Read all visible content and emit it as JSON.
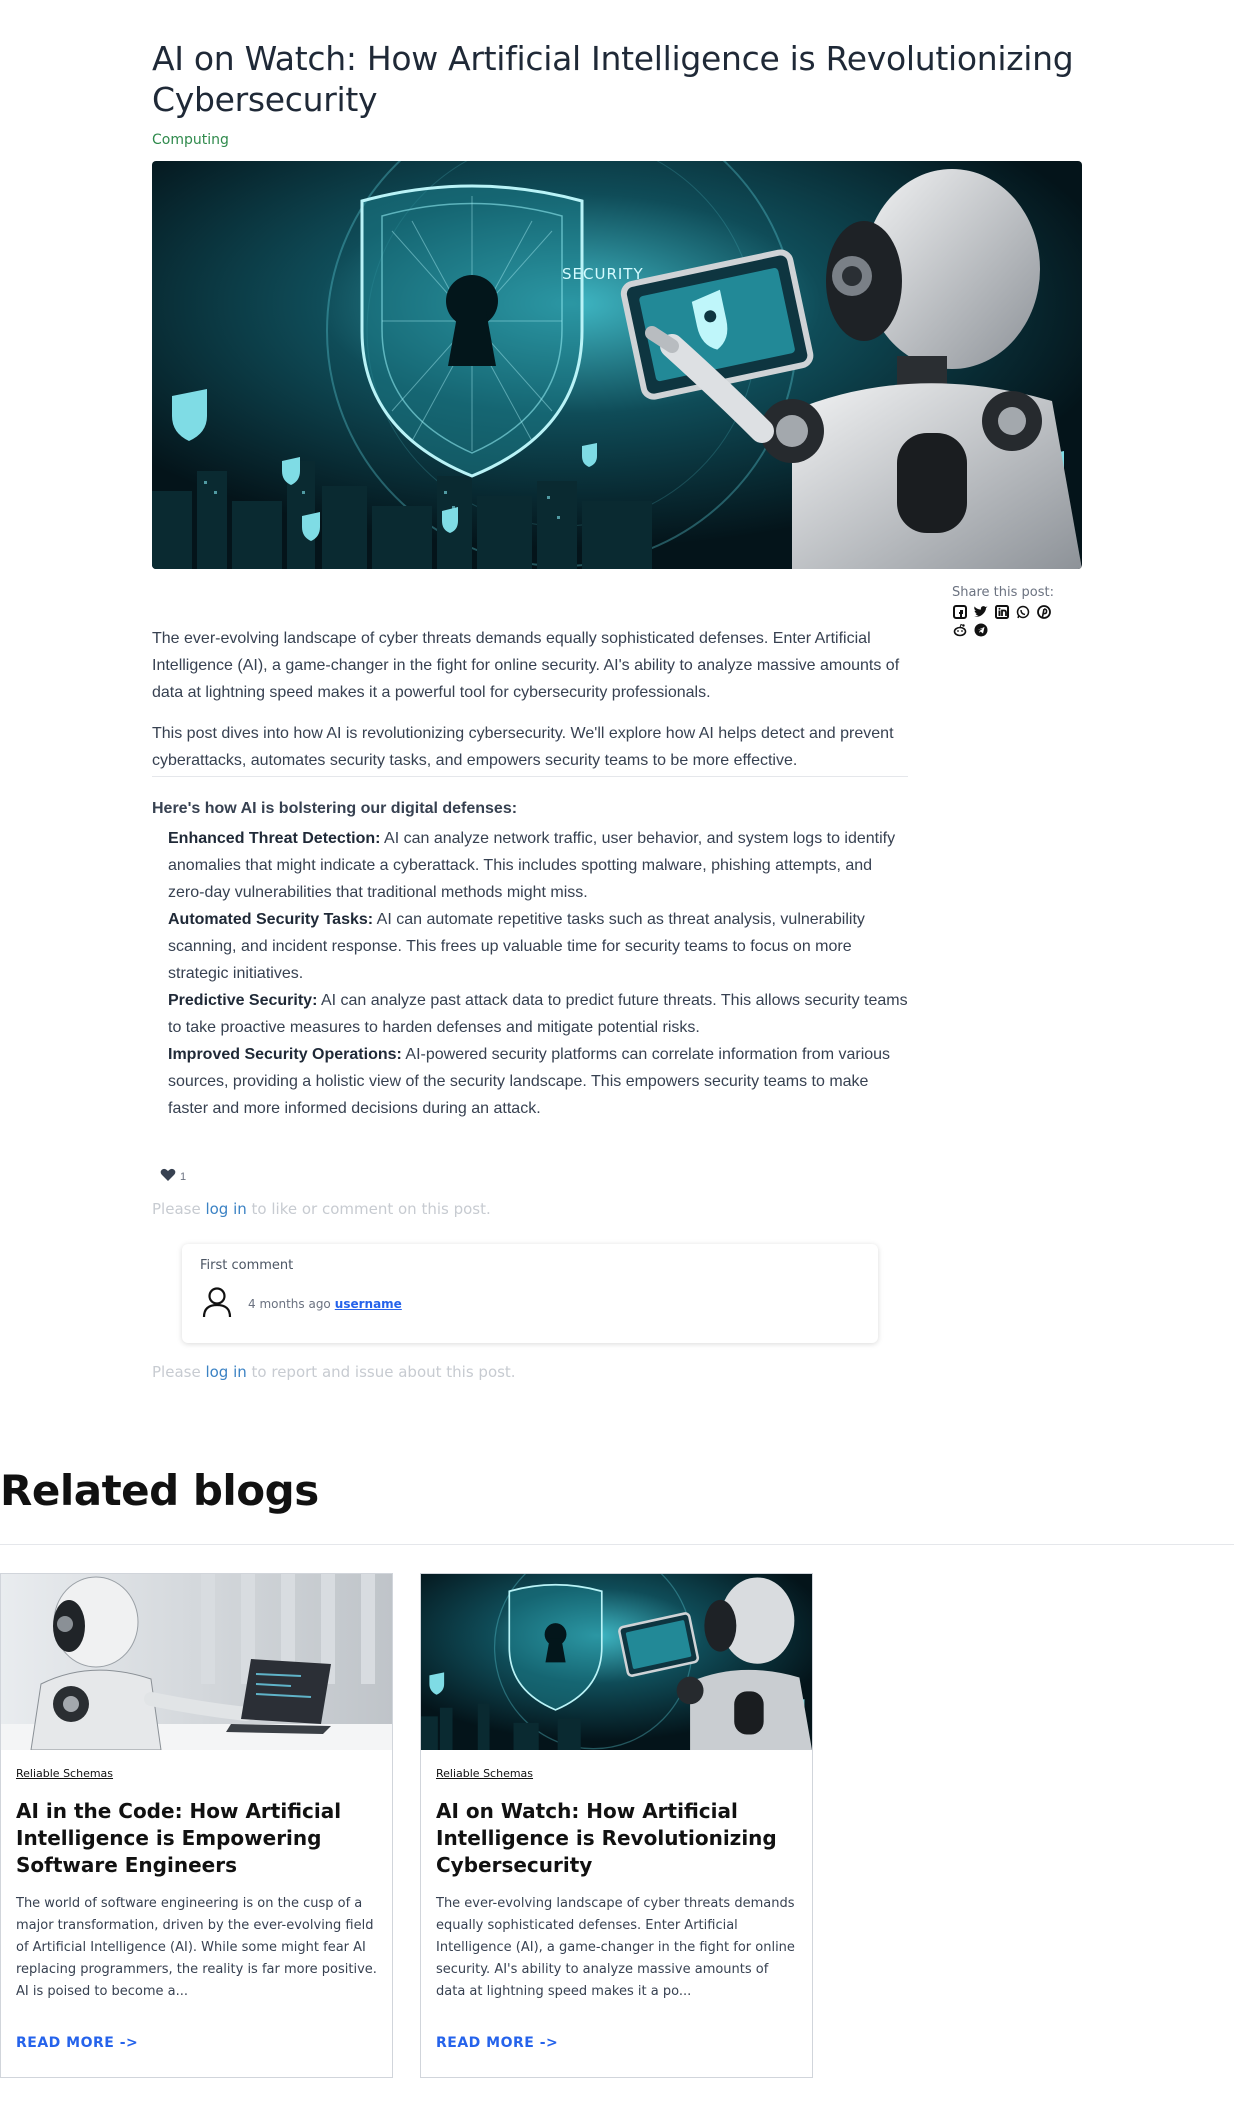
{
  "post": {
    "title": "AI on Watch: How Artificial Intelligence is Revolutionizing Cybersecurity",
    "category": "Computing",
    "hero_image": "robot-touching-security-shield-image",
    "share_label": "Share this post:",
    "share_icons": [
      "facebook-icon",
      "twitter-icon",
      "linkedin-icon",
      "whatsapp-icon",
      "pinterest-icon",
      "reddit-icon",
      "telegram-icon"
    ],
    "paragraphs": [
      "The ever-evolving landscape of cyber threats demands equally sophisticated defenses. Enter Artificial Intelligence (AI), a game-changer in the fight for online security. AI's ability to analyze massive amounts of data at lightning speed makes it a powerful tool for cybersecurity professionals.",
      "This post dives into how AI is revolutionizing cybersecurity. We'll explore how AI helps detect and prevent cyberattacks, automates security tasks, and empowers security teams to be more effective."
    ],
    "list_heading": "Here's how AI is bolstering our digital defenses:",
    "list_items": [
      {
        "title": "Enhanced Threat Detection:",
        "text": " AI can analyze network traffic, user behavior, and system logs to identify anomalies that might indicate a cyberattack. This includes spotting malware, phishing attempts, and zero-day vulnerabilities that traditional methods might miss."
      },
      {
        "title": "Automated Security Tasks:",
        "text": " AI can automate repetitive tasks such as threat analysis, vulnerability scanning, and incident response. This frees up valuable time for security teams to focus on more strategic initiatives."
      },
      {
        "title": "Predictive Security:",
        "text": " AI can analyze past attack data to predict future threats. This allows security teams to take proactive measures to harden defenses and mitigate potential risks."
      },
      {
        "title": "Improved Security Operations:",
        "text": " AI-powered security platforms can correlate information from various sources, providing a holistic view of the security landscape. This empowers security teams to make faster and more informed decisions during an attack."
      }
    ],
    "like_count": "1"
  },
  "login_prompts": {
    "comment": {
      "before": "Please ",
      "link": "log in",
      "after": " to like or comment on this post."
    },
    "report": {
      "before": "Please ",
      "link": "log in",
      "after": " to report and issue about this post."
    }
  },
  "comment": {
    "text": "First comment",
    "time": "4 months ago",
    "username": "username"
  },
  "related": {
    "heading": "Related blogs",
    "cards": [
      {
        "tag": "Reliable Schemas",
        "title": "AI in the Code: How Artificial Intelligence is Empowering Software Engineers",
        "excerpt": "The world of software engineering is on the cusp of a major transformation, driven by the ever-evolving field of Artificial Intelligence (AI). While some might fear AI replacing programmers, the reality is far more positive. AI is poised to become a...",
        "read_more": "READ MORE ->"
      },
      {
        "tag": "Reliable Schemas",
        "title": "AI on Watch: How Artificial Intelligence is Revolutionizing Cybersecurity",
        "excerpt": "The ever-evolving landscape of cyber threats demands equally sophisticated defenses. Enter Artificial Intelligence (AI), a game-changer in the fight for online security. AI's ability to analyze massive amounts of data at lightning speed makes it a po...",
        "read_more": "READ MORE ->"
      }
    ]
  }
}
